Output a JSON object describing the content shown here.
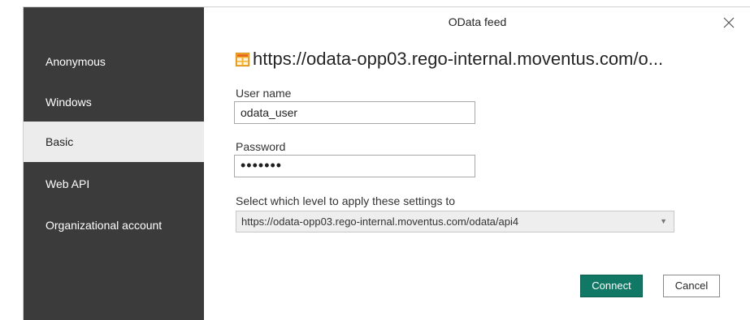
{
  "dialog": {
    "title": "OData feed",
    "close_icon": "close-x-icon"
  },
  "sidebar": {
    "items": [
      {
        "label": "Anonymous",
        "selected": false
      },
      {
        "label": "Windows",
        "selected": false
      },
      {
        "label": "Basic",
        "selected": true
      },
      {
        "label": "Web API",
        "selected": false
      },
      {
        "label": "Organizational account",
        "selected": false
      }
    ]
  },
  "feed": {
    "icon": "odata-table-icon",
    "url": "https://odata-opp03.rego-internal.moventus.com/o..."
  },
  "form": {
    "username_label": "User name",
    "username_value": "odata_user",
    "password_label": "Password",
    "password_masked": "•••••••",
    "level_label": "Select which level to apply these settings to",
    "level_value": "https://odata-opp03.rego-internal.moventus.com/odata/api4"
  },
  "buttons": {
    "connect": "Connect",
    "cancel": "Cancel"
  },
  "colors": {
    "sidebar_bg": "#3b3b3b",
    "selected_bg": "#ececec",
    "connect_bg": "#117865",
    "icon_orange": "#e8a317"
  }
}
